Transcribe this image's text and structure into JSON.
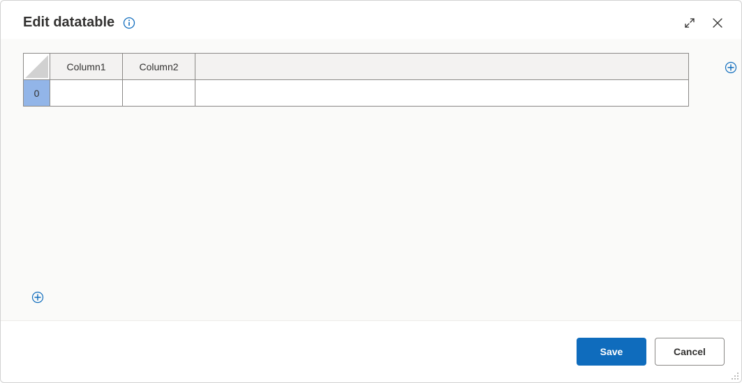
{
  "dialog": {
    "title": "Edit datatable"
  },
  "table": {
    "columns": [
      "Column1",
      "Column2"
    ],
    "rows": [
      {
        "index": "0",
        "cells": [
          "",
          ""
        ]
      }
    ]
  },
  "footer": {
    "save_label": "Save",
    "cancel_label": "Cancel"
  },
  "colors": {
    "accent": "#0f6cbd",
    "row_index_bg": "#92b5e8"
  }
}
